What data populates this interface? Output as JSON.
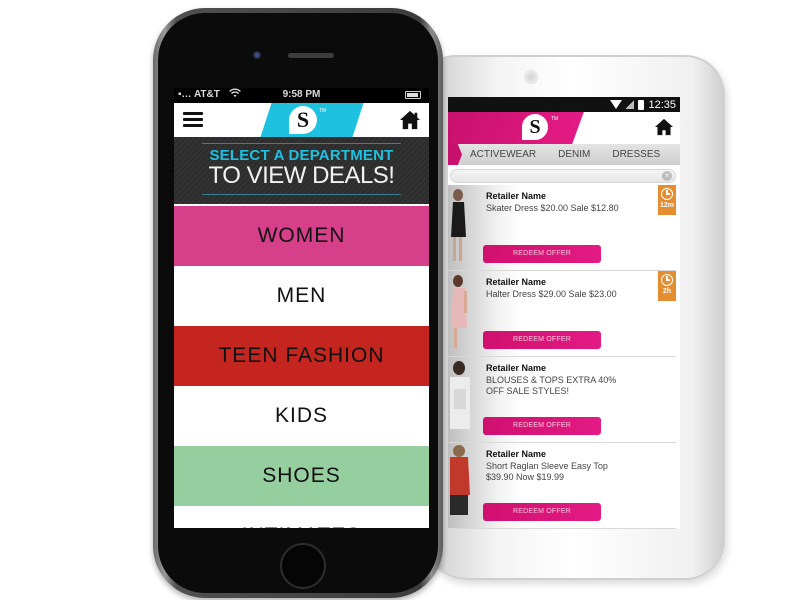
{
  "iphone": {
    "status_bar": {
      "carrier": "AT&T",
      "time": "9:58 PM"
    },
    "header": {
      "logo_letter": "S",
      "logo_tm": "TM",
      "brand_color": "#1ec1e0"
    },
    "banner": {
      "line1": "SELECT A DEPARTMENT",
      "line2": "TO VIEW DEALS!"
    },
    "departments": [
      {
        "label": "WOMEN",
        "color": "#d63f8a"
      },
      {
        "label": "MEN",
        "color": "#ffffff"
      },
      {
        "label": "TEEN FASHION",
        "color": "#c4261f"
      },
      {
        "label": "KIDS",
        "color": "#ffffff"
      },
      {
        "label": "SHOES",
        "color": "#96cf9f"
      },
      {
        "label": "INTIMATES",
        "color": "#ffffff"
      }
    ]
  },
  "android": {
    "status_bar": {
      "time": "12:35"
    },
    "header": {
      "logo_letter": "S",
      "logo_tm": "TM",
      "brand_color": "#e31b84"
    },
    "tabs": [
      "ACTIVEWEAR",
      "DENIM",
      "DRESSES"
    ],
    "search": {
      "clear_icon": "×"
    },
    "offers": [
      {
        "retailer": "Retailer Name",
        "description": "Skater Dress $20.00 Sale $12.80",
        "button": "REDEEM OFFER",
        "timer": "12m"
      },
      {
        "retailer": "Retailer Name",
        "description": "Halter Dress $29.00 Sale $23.00",
        "button": "REDEEM OFFER",
        "timer": "2h"
      },
      {
        "retailer": "Retailer Name",
        "description": "BLOUSES & TOPS EXTRA 40% OFF SALE STYLES!",
        "button": "REDEEM OFFER",
        "timer": null
      },
      {
        "retailer": "Retailer Name",
        "description": "Short Raglan Sleeve Easy Top $39.90 Now $19.99",
        "button": "REDEEM OFFER",
        "timer": null
      }
    ],
    "timer_color": "#e58d31"
  }
}
